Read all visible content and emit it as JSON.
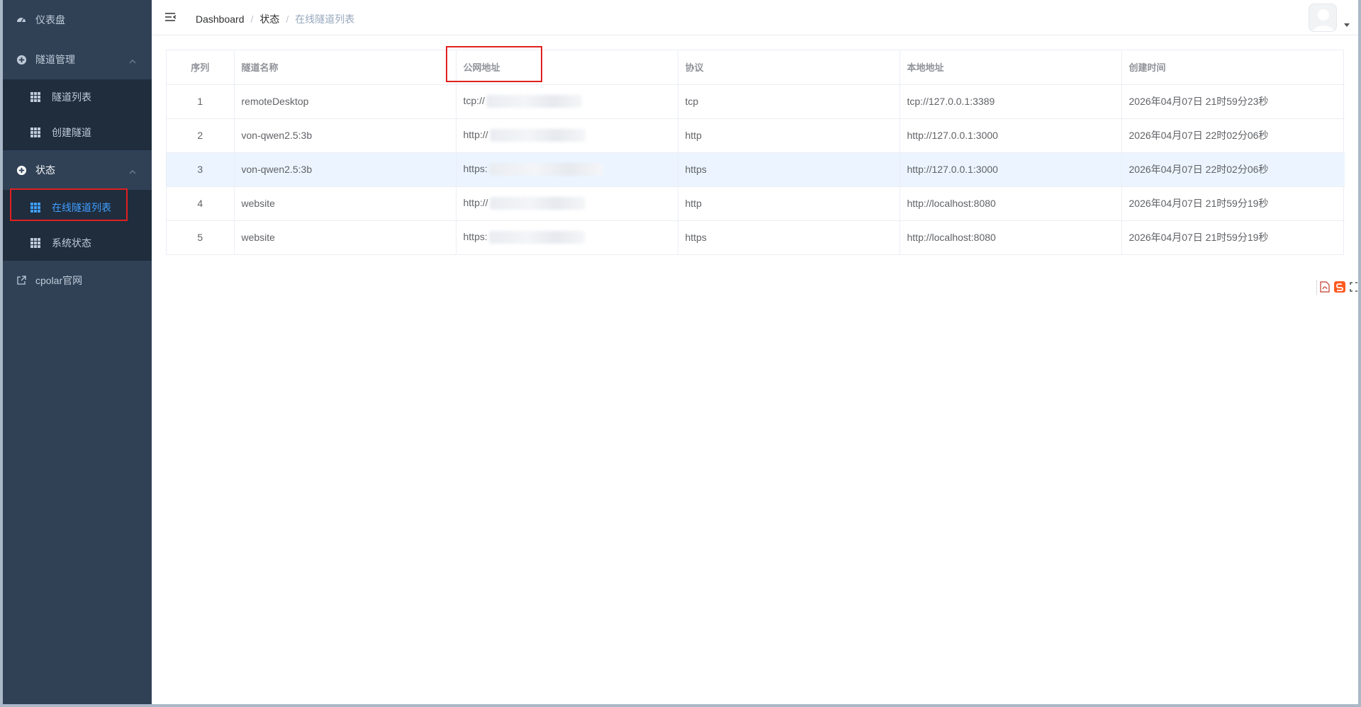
{
  "sidebar": {
    "dashboard": "仪表盘",
    "tunnel_mgmt": "隧道管理",
    "tunnel_list": "隧道列表",
    "create_tunnel": "创建隧道",
    "status": "状态",
    "online_tunnels": "在线隧道列表",
    "system_status": "系统状态",
    "official_site": "cpolar官网"
  },
  "breadcrumb": [
    "Dashboard",
    "状态",
    "在线隧道列表"
  ],
  "table": {
    "headers": [
      "序列",
      "隧道名称",
      "公网地址",
      "协议",
      "本地地址",
      "创建时间"
    ],
    "rows": [
      {
        "index": "1",
        "name": "remoteDesktop",
        "public_prefix": "tcp://",
        "protocol": "tcp",
        "local": "tcp://127.0.0.1:3389",
        "created": "2026年04月07日 21时59分23秒"
      },
      {
        "index": "2",
        "name": "von-qwen2.5:3b",
        "public_prefix": "http://",
        "protocol": "http",
        "local": "http://127.0.0.1:3000",
        "created": "2026年04月07日 22时02分06秒"
      },
      {
        "index": "3",
        "name": "von-qwen2.5:3b",
        "public_prefix": "https:",
        "protocol": "https",
        "local": "http://127.0.0.1:3000",
        "created": "2026年04月07日 22时02分06秒"
      },
      {
        "index": "4",
        "name": "website",
        "public_prefix": "http://",
        "protocol": "http",
        "local": "http://localhost:8080",
        "created": "2026年04月07日 21时59分19秒"
      },
      {
        "index": "5",
        "name": "website",
        "public_prefix": "https:",
        "protocol": "https",
        "local": "http://localhost:8080",
        "created": "2026年04月07日 21时59分19秒"
      }
    ]
  },
  "colors": {
    "sidebar_bg": "#304156",
    "submenu_bg": "#1f2d3d",
    "active": "#409eff",
    "highlight": "#e02020"
  }
}
